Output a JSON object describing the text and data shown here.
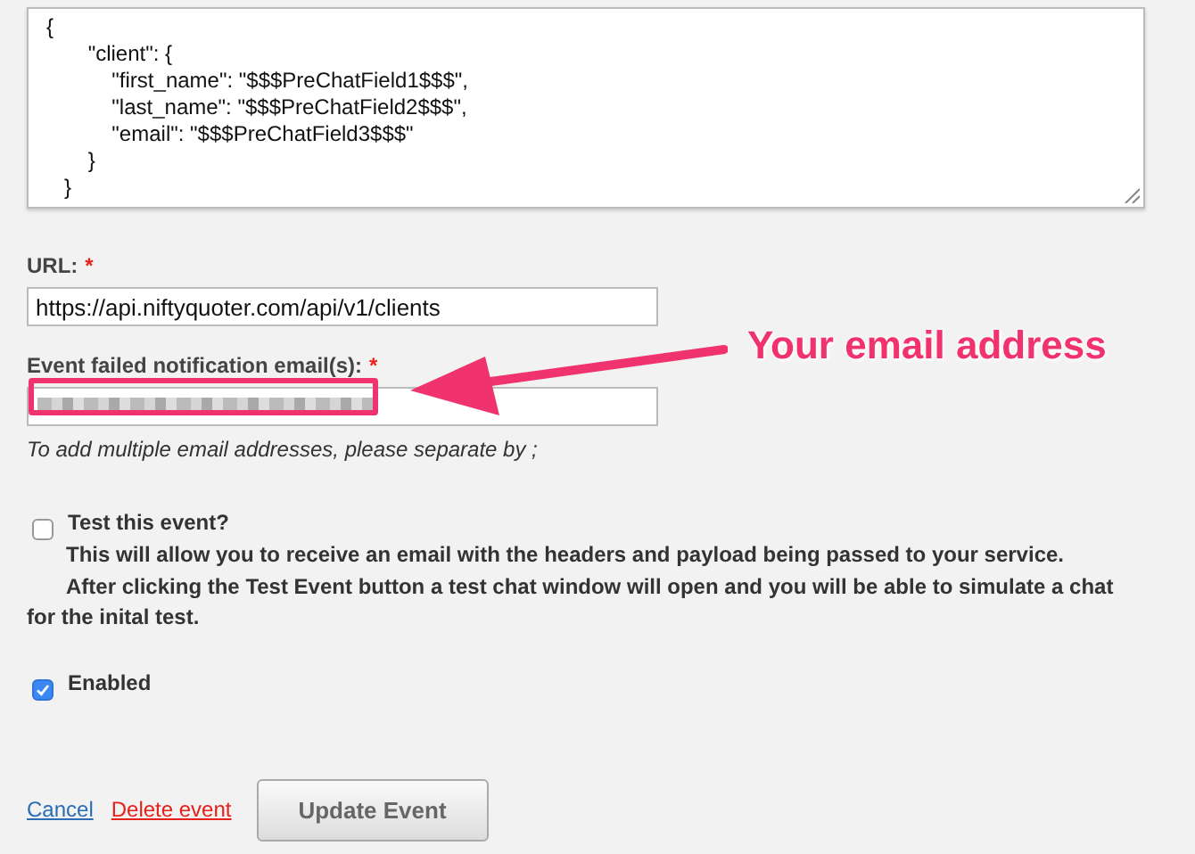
{
  "payload_editor": {
    "value": "{\n       \"client\": {\n           \"first_name\": \"$$$PreChatField1$$$\",\n           \"last_name\": \"$$$PreChatField2$$$\",\n           \"email\": \"$$$PreChatField3$$$\"\n       }\n   }"
  },
  "fields": [
    {
      "label": "URL:",
      "required_mark": "*",
      "value": "https://api.niftyquoter.com/api/v1/clients"
    },
    {
      "label": "Event failed notification email(s):",
      "required_mark": "*",
      "redacted": true,
      "hint": "To add multiple email addresses, please separate by ;"
    }
  ],
  "options": [
    {
      "label": "Test this event?",
      "checked": false,
      "description": [
        "This will allow you to receive an email with the headers and payload being passed to your service.",
        "After clicking the Test Event button a test chat window will open and you will be able to simulate a chat for the inital test."
      ]
    },
    {
      "label": "Enabled",
      "checked": true
    }
  ],
  "actions": {
    "links": [
      {
        "label": "Cancel",
        "kind": "cancel"
      },
      {
        "label": "Delete event",
        "kind": "danger"
      }
    ],
    "button": "Update Event"
  },
  "annotation": {
    "text": "Your email address"
  }
}
